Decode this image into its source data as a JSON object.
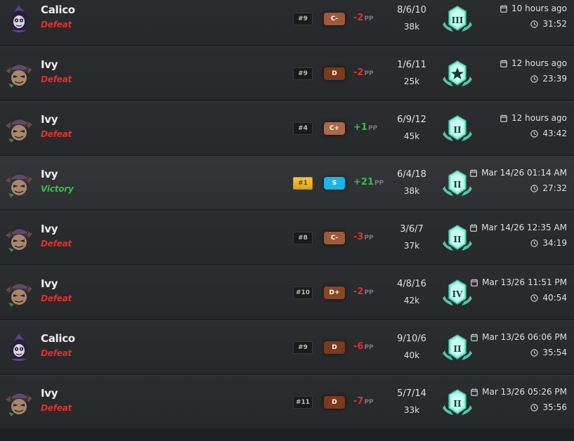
{
  "colors": {
    "defeat": "#e0302c",
    "victory": "#3bbd45",
    "rank_teal": "#5fdcc0",
    "gold_place": "#e5b52a"
  },
  "matches": [
    {
      "hero": "Calico",
      "result": "Defeat",
      "place": "#9",
      "grade": "C-",
      "grade_color": "#a0583a",
      "pp": "-2",
      "pp_unit": "PP",
      "kda": "8/6/10",
      "damage": "38k",
      "rank_label": "III",
      "date": "10 hours ago",
      "duration": "31:52"
    },
    {
      "hero": "Ivy",
      "result": "Defeat",
      "place": "#9",
      "grade": "D",
      "grade_color": "#7a3a1c",
      "pp": "-2",
      "pp_unit": "PP",
      "kda": "1/6/11",
      "damage": "25k",
      "rank_label": "★",
      "date": "12 hours ago",
      "duration": "23:39"
    },
    {
      "hero": "Ivy",
      "result": "Defeat",
      "place": "#4",
      "grade": "C+",
      "grade_color": "#a86a4a",
      "pp": "+1",
      "pp_unit": "PP",
      "kda": "6/9/12",
      "damage": "45k",
      "rank_label": "II",
      "date": "12 hours ago",
      "duration": "43:42"
    },
    {
      "hero": "Ivy",
      "result": "Victory",
      "place": "#1",
      "grade": "S",
      "grade_color": "#1fb3e6",
      "pp": "+21",
      "pp_unit": "PP",
      "kda": "6/4/18",
      "damage": "38k",
      "rank_label": "II",
      "date": "Mar 14/26 01:14 AM",
      "duration": "27:32"
    },
    {
      "hero": "Ivy",
      "result": "Defeat",
      "place": "#8",
      "grade": "C-",
      "grade_color": "#a0583a",
      "pp": "-3",
      "pp_unit": "PP",
      "kda": "3/6/7",
      "damage": "37k",
      "rank_label": "II",
      "date": "Mar 14/26 12:35 AM",
      "duration": "34:19"
    },
    {
      "hero": "Ivy",
      "result": "Defeat",
      "place": "#10",
      "grade": "D+",
      "grade_color": "#8a4622",
      "pp": "-2",
      "pp_unit": "PP",
      "kda": "4/8/16",
      "damage": "42k",
      "rank_label": "IV",
      "date": "Mar 13/26 11:51 PM",
      "duration": "40:54"
    },
    {
      "hero": "Calico",
      "result": "Defeat",
      "place": "#9",
      "grade": "D",
      "grade_color": "#7a3a1c",
      "pp": "-6",
      "pp_unit": "PP",
      "kda": "9/10/6",
      "damage": "40k",
      "rank_label": "II",
      "date": "Mar 13/26 06:06 PM",
      "duration": "35:54"
    },
    {
      "hero": "Ivy",
      "result": "Defeat",
      "place": "#11",
      "grade": "D",
      "grade_color": "#7a3a1c",
      "pp": "-7",
      "pp_unit": "PP",
      "kda": "5/7/14",
      "damage": "33k",
      "rank_label": "II",
      "date": "Mar 13/26 05:26 PM",
      "duration": "35:56"
    }
  ]
}
